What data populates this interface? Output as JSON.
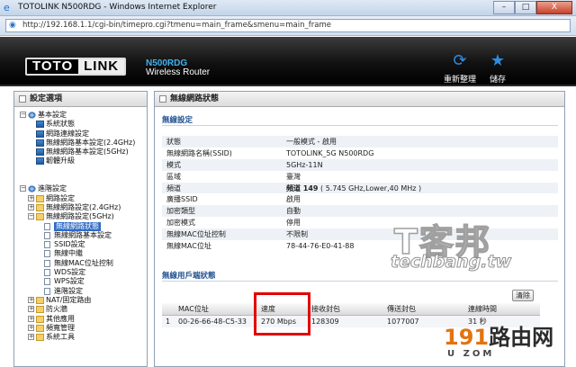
{
  "window": {
    "title": "TOTOLINK N500RDG - Windows Internet Explorer",
    "url": "http://192.168.1.1/cgi-bin/timepro.cgi?tmenu=main_frame&smenu=main_frame",
    "minimize": "–",
    "maximize": "□",
    "close": "X"
  },
  "header": {
    "logo_left": "TOTO",
    "logo_right": "LINK",
    "model": "N500RDG",
    "product": "Wireless Router",
    "refresh_label": "重新整理",
    "save_label": "儲存"
  },
  "sidebar": {
    "title": "設定選項",
    "items": [
      {
        "label": "基本設定"
      },
      {
        "label": "系統狀態"
      },
      {
        "label": "網路連線設定"
      },
      {
        "label": "無線網路基本設定(2.4GHz)"
      },
      {
        "label": "無線網路基本設定(5GHz)"
      },
      {
        "label": "韌體升級"
      },
      {
        "label": "進階設定"
      },
      {
        "label": "網路設定"
      },
      {
        "label": "無線網路設定(2.4GHz)"
      },
      {
        "label": "無線網路設定(5GHz)"
      },
      {
        "label": "無線網路狀態"
      },
      {
        "label": "無線網路基本設定"
      },
      {
        "label": "SSID設定"
      },
      {
        "label": "無線中繼"
      },
      {
        "label": "無線MAC位址控制"
      },
      {
        "label": "WDS設定"
      },
      {
        "label": "WPS設定"
      },
      {
        "label": "進階設定"
      },
      {
        "label": "NAT/固定路由"
      },
      {
        "label": "防火牆"
      },
      {
        "label": "其他應用"
      },
      {
        "label": "頻寬管理"
      },
      {
        "label": "系統工具"
      }
    ]
  },
  "main": {
    "page_title": "無線網路狀態",
    "wireless_section": "無線設定",
    "info": [
      {
        "key": "狀態",
        "value": "一般模式 - 啟用"
      },
      {
        "key": "無線網路名稱(SSID)",
        "value": "TOTOLINK_5G N500RDG"
      },
      {
        "key": "模式",
        "value": "5GHz-11N"
      },
      {
        "key": "區域",
        "value": "臺灣"
      },
      {
        "key": "頻道",
        "value_bold": "頻道 149",
        "value": "( 5.745 GHz,Lower,40 MHz )"
      },
      {
        "key": "廣播SSID",
        "value": "啟用"
      },
      {
        "key": "加密類型",
        "value": "自動"
      },
      {
        "key": "加密模式",
        "value": "停用"
      },
      {
        "key": "無線MAC位址控制",
        "value": "不限制"
      },
      {
        "key": "無線MAC位址",
        "value": "78-44-76-E0-41-88"
      }
    ],
    "clients_section": "無線用戶端狀態",
    "clear_label": "清除",
    "clients_headers": [
      "MAC位址",
      "速度",
      "接收封包",
      "傳送封包",
      "連線時間"
    ],
    "clients_rows": [
      {
        "index": "1",
        "mac": "00-26-66-48-C5-33",
        "speed": "270 Mbps",
        "rx": "128309",
        "tx": "1077007",
        "time": "31 秒"
      }
    ]
  },
  "watermarks": {
    "site_logo": "T客邦",
    "site_url": "techbang.tw",
    "router_site": "路由网",
    "router_prefix": "191",
    "router_small": "U ZOM"
  },
  "colors": {
    "section_title": "#1f4f8f",
    "highlight_border": "#e20000",
    "selected_bg": "#316ac5",
    "model_color": "#3fb2f0"
  }
}
